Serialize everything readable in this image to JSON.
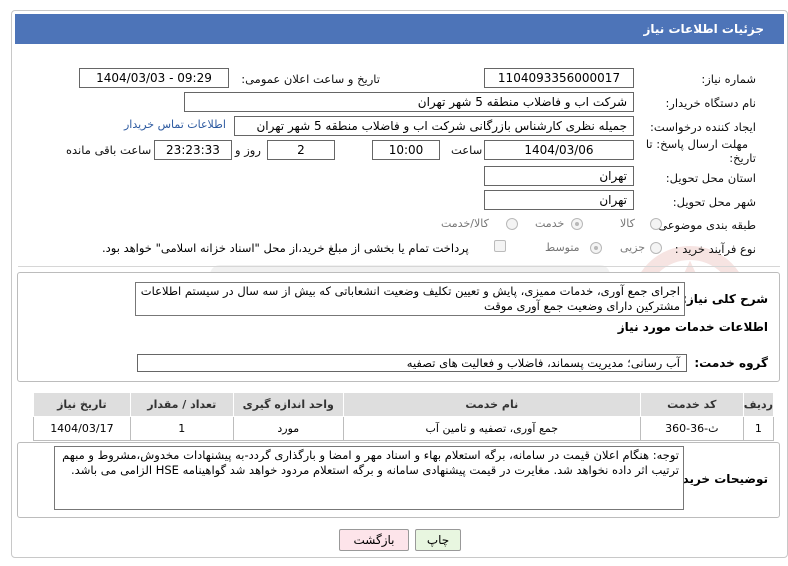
{
  "header": {
    "title": "جزئیات اطلاعات نیاز"
  },
  "fields": {
    "need_number_label": "شماره نیاز:",
    "need_number": "1104093356000017",
    "announce_label": "تاریخ و ساعت اعلان عمومی:",
    "announce_value": "1404/03/03 - 09:29",
    "buyer_label": "نام دستگاه خریدار:",
    "buyer_value": "شرکت اب و فاضلاب منطقه 5 شهر تهران",
    "creator_label": "ایجاد کننده درخواست:",
    "creator_value": "جمیله نظری کارشناس بازرگانی شرکت اب و فاضلاب منطقه 5 شهر تهران",
    "contact_link": "اطلاعات تماس خریدار",
    "deadline_label_1": "مهلت ارسال پاسخ: تا",
    "deadline_label_2": "تاریخ:",
    "deadline_date": "1404/03/06",
    "time_label": "ساعت",
    "deadline_time": "10:00",
    "days_value": "2",
    "days_label": "روز و",
    "remaining_time": "23:23:33",
    "remaining_label": "ساعت باقی مانده",
    "province_label": "استان محل تحویل:",
    "province_value": "تهران",
    "city_label": "شهر محل تحویل:",
    "city_value": "تهران",
    "category_label": "طبقه بندی موضوعی:",
    "category_options": [
      "کالا",
      "خدمت",
      "کالا/خدمت"
    ],
    "process_label": "نوع فرآیند خرید :",
    "process_options": [
      "جزیی",
      "متوسط"
    ],
    "payment_note": "پرداخت تمام یا بخشی از مبلغ خرید،از محل \"اسناد خزانه اسلامی\" خواهد بود."
  },
  "description": {
    "label": "شرح کلی نیاز:",
    "text": "اجرای جمع آوری، خدمات ممیزی، پایش و تعیین تکلیف وضعیت انشعاباتی که بیش از سه  سال در سیستم اطلاعات مشترکین دارای وضعیت جمع آوری موقت"
  },
  "services": {
    "title": "اطلاعات خدمات مورد نیاز",
    "group_label": "گروه خدمت:",
    "group_value": "آب رسانی؛ مدیریت پسماند، فاضلاب و فعالیت های تصفیه"
  },
  "table": {
    "headers": [
      "ردیف",
      "کد خدمت",
      "نام خدمت",
      "واحد اندازه گیری",
      "تعداد / مقدار",
      "تاریخ نیاز"
    ],
    "rows": [
      [
        "1",
        "ث-36-360",
        "جمع آوری، تصفیه و تامین آب",
        "مورد",
        "1",
        "1404/03/17"
      ]
    ]
  },
  "buyer_notes": {
    "label": "توضیحات خریدار:",
    "text": "توجه: هنگام اعلان قیمت در سامانه، برگه استعلام بهاء و اسناد مهر و امضا و بارگذاری گردد-به پیشنهادات مخدوش،مشروط و مبهم ترتیب اثر داده نخواهد شد. مغایرت در قیمت پیشنهادی سامانه و برگه استعلام مردود خواهد شد گواهینامه HSE الزامی می باشد."
  },
  "buttons": {
    "print": "چاپ",
    "back": "بازگشت"
  },
  "colors": {
    "header_bg": "#4d74b8",
    "print_btn_bg": "#e8f6e0",
    "back_btn_bg": "#fde4ea",
    "link": "#2d5aa0"
  }
}
